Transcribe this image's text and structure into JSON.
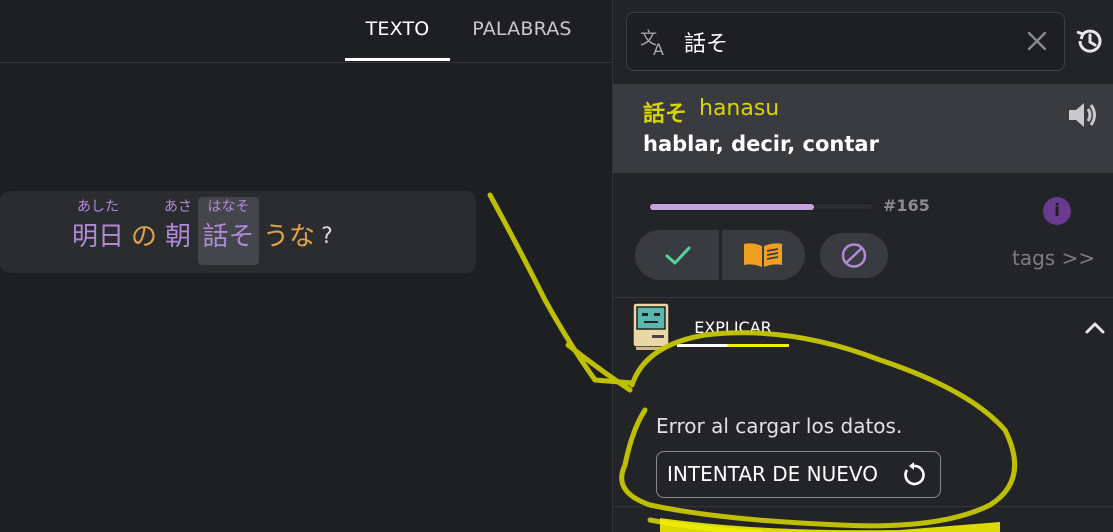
{
  "tabs": {
    "texto": "TEXTO",
    "palabras": "PALABRAS",
    "active": "TEXTO"
  },
  "sentence": {
    "words": [
      {
        "base": "明日",
        "furigana": "あした"
      },
      {
        "base": "の",
        "furigana": ""
      },
      {
        "base": "朝",
        "furigana": "あさ"
      },
      {
        "base": "話そ",
        "furigana": "はなそ",
        "selected": true
      },
      {
        "base": "うな",
        "furigana": ""
      },
      {
        "base": "?",
        "furigana": ""
      }
    ]
  },
  "search": {
    "value": "話そ",
    "icon": "translate-icon",
    "clear_icon": "close-icon"
  },
  "history_icon": "history-icon",
  "entry": {
    "kana": "話そ",
    "romaji": "hanasu",
    "gloss": "hablar, decir, contar",
    "speaker_icon": "speaker-icon"
  },
  "stats": {
    "rank": "#165",
    "progress_fraction": 0.74
  },
  "actions": {
    "known_icon": "check-icon",
    "learning_icon": "book-icon",
    "ignore_icon": "ban-icon",
    "tags": "tags >>"
  },
  "explain": {
    "tab": "EXPLICAR",
    "icon": "retro-computer-icon",
    "collapse_icon": "chevron-up-icon"
  },
  "error": {
    "message": "Error al cargar los datos.",
    "retry": "INTENTAR DE NUEVO",
    "retry_icon": "refresh-icon"
  },
  "colors": {
    "background": "#1e1f22",
    "panel": "#232427",
    "entry_bg": "#3a3b40",
    "highlight_yellow": "#d8d600",
    "furigana_purple": "#b08ad6",
    "particle_orange": "#e0a24a",
    "check_green": "#4fd6a0",
    "book_orange": "#f0a020",
    "info_purple": "#6a3a8e",
    "scribble": "#c8c800"
  }
}
